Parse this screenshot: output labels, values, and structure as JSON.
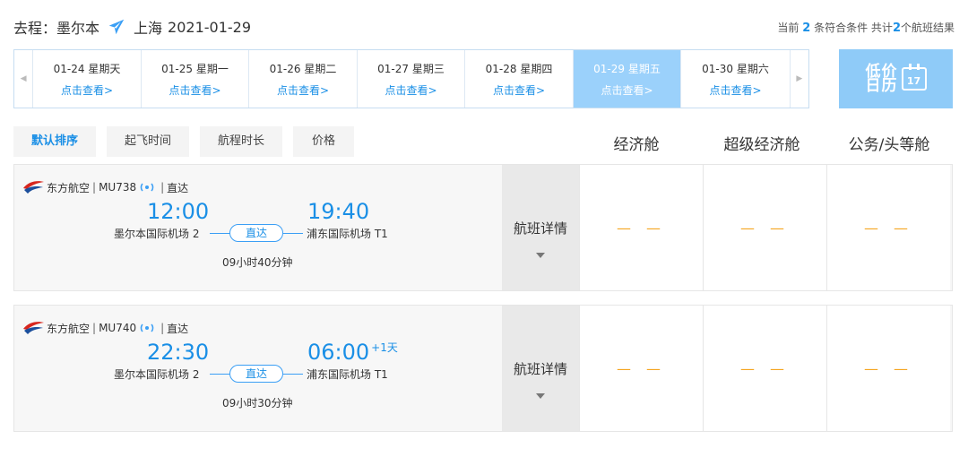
{
  "header": {
    "trip_label": "去程：墨尔本",
    "destination": "上海",
    "date": "2021-01-29",
    "count_prefix": "当前",
    "count_value": "2",
    "count_mid": "条符合条件 共计",
    "total_value": "2",
    "count_suffix": "个航班结果"
  },
  "date_strip": {
    "prev_icon": "◀",
    "next_icon": "▶",
    "dates": [
      {
        "date": "01-24 星期天",
        "link": "点击查看>"
      },
      {
        "date": "01-25 星期一",
        "link": "点击查看>"
      },
      {
        "date": "01-26 星期二",
        "link": "点击查看>"
      },
      {
        "date": "01-27 星期三",
        "link": "点击查看>"
      },
      {
        "date": "01-28 星期四",
        "link": "点击查看>"
      },
      {
        "date": "01-29 星期五",
        "link": "点击查看>"
      },
      {
        "date": "01-30 星期六",
        "link": "点击查看>"
      }
    ],
    "active_index": 5
  },
  "lowprice_calendar": {
    "label": "低价日历",
    "day": "17"
  },
  "sort": {
    "buttons": [
      "默认排序",
      "起飞时间",
      "航程时长",
      "价格"
    ],
    "active_index": 0
  },
  "cabins": [
    "经济舱",
    "超级经济舱",
    "公务/头等舱"
  ],
  "flights": [
    {
      "airline": "东方航空",
      "flight_no": "MU738",
      "type": "直达",
      "dep_time": "12:00",
      "arr_time": "19:40",
      "plus_day": "",
      "dep_airport": "墨尔本国际机场 2",
      "arr_airport": "浦东国际机场 T1",
      "direct_label": "直达",
      "duration": "09小时40分钟",
      "detail_label": "航班详情",
      "prices": [
        "— —",
        "— —",
        "— —"
      ]
    },
    {
      "airline": "东方航空",
      "flight_no": "MU740",
      "type": "直达",
      "dep_time": "22:30",
      "arr_time": "06:00",
      "plus_day": "+1天",
      "dep_airport": "墨尔本国际机场 2",
      "arr_airport": "浦东国际机场 T1",
      "direct_label": "直达",
      "duration": "09小时30分钟",
      "detail_label": "航班详情",
      "prices": [
        "— —",
        "— —",
        "— —"
      ]
    }
  ],
  "colors": {
    "accent": "#1a8fe6",
    "active_date_bg": "#9bd1fb",
    "price_dash": "#f5a623",
    "airline_red": "#d7261e",
    "airline_blue": "#1c4f9c"
  }
}
